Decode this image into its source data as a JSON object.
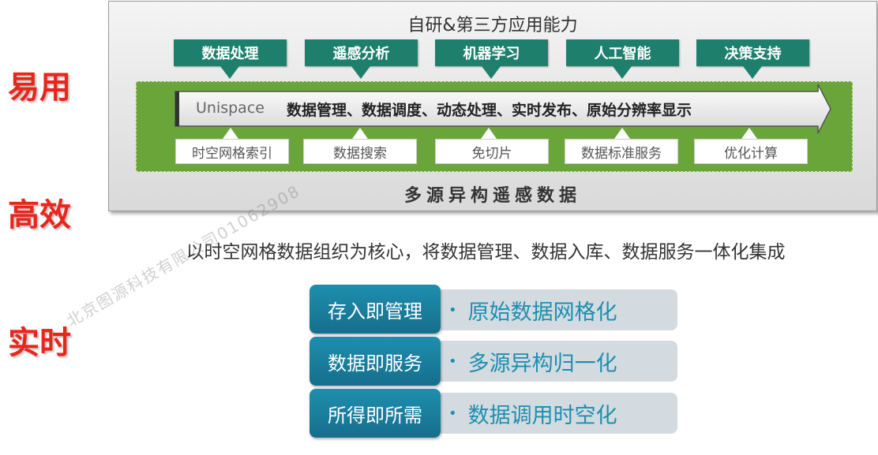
{
  "side_labels": [
    "易用",
    "高效",
    "实时"
  ],
  "panel": {
    "title": "自研&第三方应用能力",
    "capabilities": [
      "数据处理",
      "遥感分析",
      "机器学习",
      "人工智能",
      "决策支持"
    ],
    "unispace": {
      "name": "Unispace",
      "functions": "数据管理、数据调度、动态处理、实时发布、原始分辨率显示"
    },
    "features": [
      "时空网格索引",
      "数据搜索",
      "免切片",
      "数据标准服务",
      "优化计算"
    ],
    "bottom_label": "多源异构遥感数据"
  },
  "summary": "以时空网格数据组织为核心，将数据管理、数据入库、数据服务一体化集成",
  "rows": [
    {
      "head": "存入即管理",
      "item": "原始数据网格化"
    },
    {
      "head": "数据即服务",
      "item": "多源异构归一化"
    },
    {
      "head": "所得即所需",
      "item": "数据调用时空化"
    }
  ],
  "watermark": "北京图源科技有限公司01062908",
  "colors": {
    "accent_red": "#e8261c",
    "cap_green": "#1f7f6d",
    "band_green": "#6aa53a",
    "row_blue": "#1f8eaf",
    "row_text": "#1c8fb0"
  }
}
